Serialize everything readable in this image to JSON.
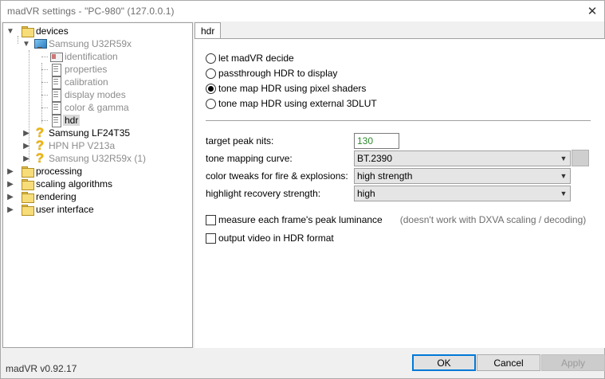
{
  "window": {
    "title": "madVR settings - \"PC-980\" (127.0.0.1)",
    "close_glyph": "✕"
  },
  "tree": {
    "nodes": [
      {
        "label": "devices",
        "icon": "folder-icon",
        "expanded": true
      },
      {
        "label": "Samsung U32R59x",
        "icon": "monitor-icon",
        "expanded": true,
        "disabled": true
      },
      {
        "label": "identification",
        "icon": "idcard-icon",
        "disabled": true
      },
      {
        "label": "properties",
        "icon": "document-icon",
        "disabled": true
      },
      {
        "label": "calibration",
        "icon": "document-icon",
        "disabled": true
      },
      {
        "label": "display modes",
        "icon": "document-icon",
        "disabled": true
      },
      {
        "label": "color & gamma",
        "icon": "document-icon",
        "disabled": true
      },
      {
        "label": "hdr",
        "icon": "document-icon",
        "selected": true
      },
      {
        "label": "Samsung LF24T35",
        "icon": "question-icon"
      },
      {
        "label": "HPN HP V213a",
        "icon": "question-icon",
        "disabled": true
      },
      {
        "label": "Samsung U32R59x (1)",
        "icon": "question-icon",
        "disabled": true
      },
      {
        "label": "processing",
        "icon": "folder-icon"
      },
      {
        "label": "scaling algorithms",
        "icon": "folder-icon"
      },
      {
        "label": "rendering",
        "icon": "folder-icon"
      },
      {
        "label": "user interface",
        "icon": "folder-icon"
      }
    ]
  },
  "tab": {
    "label": "hdr"
  },
  "hdr": {
    "options": [
      {
        "label": "let madVR decide",
        "checked": false
      },
      {
        "label": "passthrough HDR to display",
        "checked": false
      },
      {
        "label": "tone map HDR using pixel shaders",
        "checked": true
      },
      {
        "label": "tone map HDR using external 3DLUT",
        "checked": false
      }
    ],
    "target_peak_nits_label": "target peak nits:",
    "target_peak_nits_value": "130",
    "tone_curve_label": "tone mapping curve:",
    "tone_curve_value": "BT.2390",
    "color_tweaks_label": "color tweaks for fire & explosions:",
    "color_tweaks_value": "high strength",
    "highlight_label": "highlight recovery strength:",
    "highlight_value": "high",
    "measure_label": "measure each frame's peak luminance",
    "measure_note": "(doesn't work with DXVA scaling / decoding)",
    "measure_checked": false,
    "output_label": "output video in HDR format",
    "output_checked": false
  },
  "footer": {
    "version": "madVR v0.92.17",
    "ok_label": "OK",
    "cancel_label": "Cancel",
    "apply_label": "Apply"
  },
  "colors": {
    "accent": "#0078d7",
    "nits_value": "#2e8b2e",
    "disabled_text": "#8c8c8c"
  }
}
